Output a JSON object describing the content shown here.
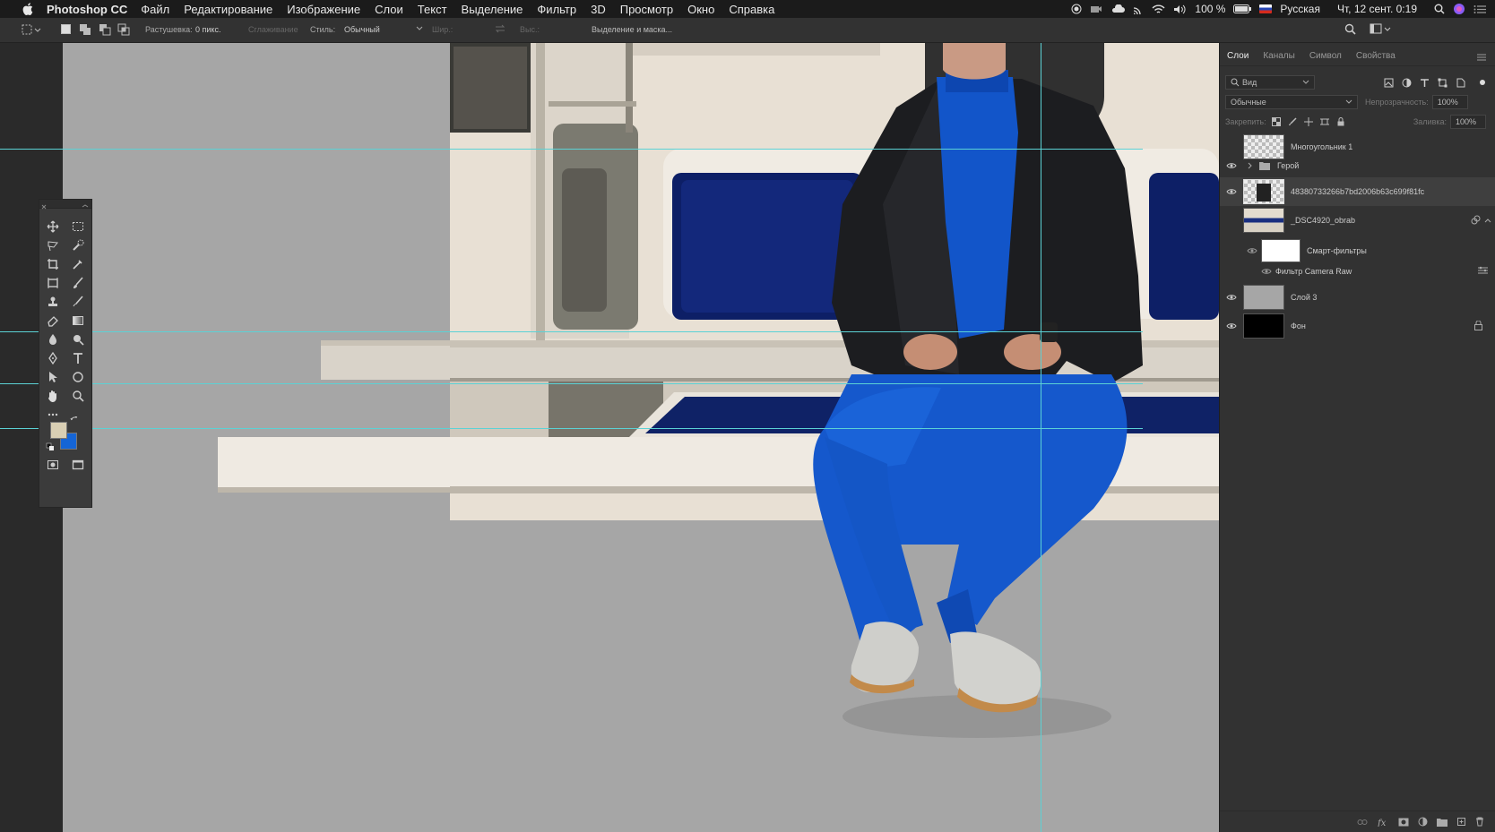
{
  "menubar": {
    "app_name": "Photoshop CC",
    "items": [
      "Файл",
      "Редактирование",
      "Изображение",
      "Слои",
      "Текст",
      "Выделение",
      "Фильтр",
      "3D",
      "Просмотр",
      "Окно",
      "Справка"
    ],
    "battery": "100 %",
    "input_source": "Русская",
    "datetime": "Чт, 12 сент.  0:19"
  },
  "optionsbar": {
    "feather_label": "Растушевка:",
    "feather_value": "0 пикс.",
    "antialias_label": "Сглаживание",
    "style_label": "Стиль:",
    "style_value": "Обычный",
    "width_label": "Шир.:",
    "height_label": "Выс.:",
    "select_mask_label": "Выделение и маска..."
  },
  "layers_panel": {
    "tabs": [
      "Слои",
      "Каналы",
      "Символ",
      "Свойства"
    ],
    "filter_label": "Вид",
    "blend_mode": "Обычные",
    "opacity_label": "Непрозрачность:",
    "opacity_value": "100%",
    "lock_label": "Закрепить:",
    "fill_label": "Заливка:",
    "fill_value": "100%",
    "layers": [
      {
        "name": "Многоугольник 1"
      },
      {
        "name": "Герой"
      },
      {
        "name": "48380733266b7bd2006b63c699f81fc"
      },
      {
        "name": "_DSC4920_obrab"
      },
      {
        "name": "Смарт-фильтры"
      },
      {
        "name": "Фильтр Camera Raw"
      },
      {
        "name": "Слой 3"
      },
      {
        "name": "Фон"
      }
    ]
  },
  "colors": {
    "foreground": "#d9cfb4",
    "background": "#1565d6",
    "guide": "#5bd2d5",
    "canvas": "#a6a6a6"
  }
}
